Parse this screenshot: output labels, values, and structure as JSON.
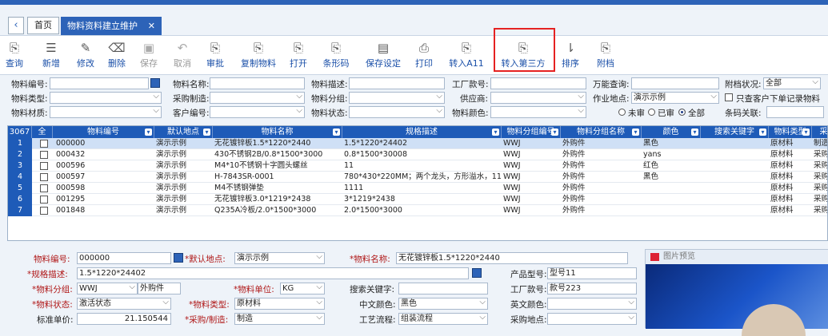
{
  "tabs": {
    "home": "首页",
    "active": "物料资料建立维护",
    "back_icon": "chevron-left-icon"
  },
  "toolbar": [
    {
      "name": "query",
      "label": "查询",
      "icon": "⎘",
      "dis": false
    },
    {
      "name": "add",
      "label": "新增",
      "icon": "☰",
      "dis": false
    },
    {
      "name": "edit",
      "label": "修改",
      "icon": "✎",
      "dis": false
    },
    {
      "name": "delete",
      "label": "删除",
      "icon": "⌫",
      "dis": false
    },
    {
      "name": "save",
      "label": "保存",
      "icon": "▣",
      "dis": true
    },
    {
      "name": "cancel",
      "label": "取消",
      "icon": "↶",
      "dis": true
    },
    {
      "name": "approve",
      "label": "审批",
      "icon": "⎘",
      "dis": false
    },
    {
      "name": "copy",
      "label": "复制物料",
      "icon": "⎘",
      "dis": false
    },
    {
      "name": "open",
      "label": "打开",
      "icon": "⎘",
      "dis": false
    },
    {
      "name": "barcode",
      "label": "条形码",
      "icon": "⎘",
      "dis": false
    },
    {
      "name": "save-settings",
      "label": "保存设定",
      "icon": "▤",
      "dis": false
    },
    {
      "name": "print",
      "label": "打印",
      "icon": "⎙",
      "dis": false
    },
    {
      "name": "to-a11",
      "label": "转入A11",
      "icon": "⎘",
      "dis": false
    },
    {
      "name": "to-third-party",
      "label": "转入第三方",
      "icon": "⎘",
      "dis": false
    },
    {
      "name": "sort",
      "label": "排序",
      "icon": "⇂",
      "dis": false
    },
    {
      "name": "attachment",
      "label": "附档",
      "icon": "⎘",
      "dis": false
    }
  ],
  "filters": {
    "code": "物料编号:",
    "name": "物料名称:",
    "desc": "物料描述:",
    "factory_no": "工厂款号:",
    "universal": "万能查询:",
    "attach_status": "附档状况:",
    "attach_value": "全部",
    "type": "物料类型:",
    "purchase": "采购制造:",
    "group": "物料分组:",
    "supplier": "供应商:",
    "site": "作业地点:",
    "site_value": "演示示例",
    "only_orders": "只查客户下单记录物料",
    "material": "物料材质:",
    "customer_no": "客户编号:",
    "status": "物料状态:",
    "color": "物料颜色:",
    "r_unapproved": "未审",
    "r_approved": "已审",
    "r_all": "全部",
    "barcode": "条码关联:"
  },
  "grid": {
    "count": "3067",
    "all": "全",
    "headers": [
      "物料编号",
      "默认地点",
      "物料名称",
      "规格描述",
      "物料分组编号",
      "物料分组名称",
      "颜色",
      "搜索关键字",
      "物料类型",
      "采购"
    ],
    "rows": [
      [
        "1",
        "000000",
        "演示示例",
        "无花镀锌板1.5*1220*2440",
        "1.5*1220*24402",
        "WWJ",
        "外购件",
        "黑色",
        "",
        "原材料",
        "制造"
      ],
      [
        "2",
        "000432",
        "演示示例",
        "430不锈钢2B/0.8*1500*3000",
        "0.8*1500*30008",
        "WWJ",
        "外购件",
        "yans",
        "",
        "原材料",
        "采购"
      ],
      [
        "3",
        "000596",
        "演示示例",
        "M4*10不锈钢十字圆头螺丝",
        "11",
        "WWJ",
        "外购件",
        "红色",
        "",
        "原材料",
        "采购"
      ],
      [
        "4",
        "000597",
        "演示示例",
        "H-7843SR-0001",
        "780*430*220MM；两个龙头，方形溢水，11",
        "WWJ",
        "外购件",
        "黑色",
        "",
        "原材料",
        "采购"
      ],
      [
        "5",
        "000598",
        "演示示例",
        "M4不锈钢弹垫",
        "1111",
        "WWJ",
        "外购件",
        "",
        "",
        "原材料",
        "采购"
      ],
      [
        "6",
        "001295",
        "演示示例",
        "无花镀锌板3.0*1219*2438",
        "3*1219*2438",
        "WWJ",
        "外购件",
        "",
        "",
        "原材料",
        "采购"
      ],
      [
        "7",
        "001848",
        "演示示例",
        "Q235A冷板/2.0*1500*3000",
        "2.0*1500*3000",
        "WWJ",
        "外购件",
        "",
        "",
        "原材料",
        "采购"
      ]
    ]
  },
  "detail": {
    "code_l": "物料编号:",
    "code_v": "000000",
    "site_l": "*默认地点:",
    "site_v": "演示示例",
    "name_l": "*物料名称:",
    "name_v": "无花镀锌板1.5*1220*2440",
    "spec_l": "*规格描述:",
    "spec_v": "1.5*1220*24402",
    "model_l": "产品型号:",
    "model_v": "型号11",
    "group_l": "*物料分组:",
    "group_v": "WWJ",
    "group_n": "外购件",
    "unit_l": "*物料单位:",
    "unit_v": "KG",
    "kw_l": "搜索关键字:",
    "factory_l": "工厂款号:",
    "factory_v": "款号223",
    "status_l": "*物料状态:",
    "status_v": "激活状态",
    "type_l": "*物料类型:",
    "type_v": "原材料",
    "cn_color_l": "中文颜色:",
    "cn_color_v": "黑色",
    "en_color_l": "英文颜色:",
    "price_l": "标准单价:",
    "price_v": "21.150544",
    "pm_l": "*采购/制造:",
    "pm_v": "制造",
    "flow_l": "工艺流程:",
    "flow_v": "组装流程",
    "pur_site_l": "采购地点:"
  },
  "preview": {
    "title": "图片预览"
  }
}
